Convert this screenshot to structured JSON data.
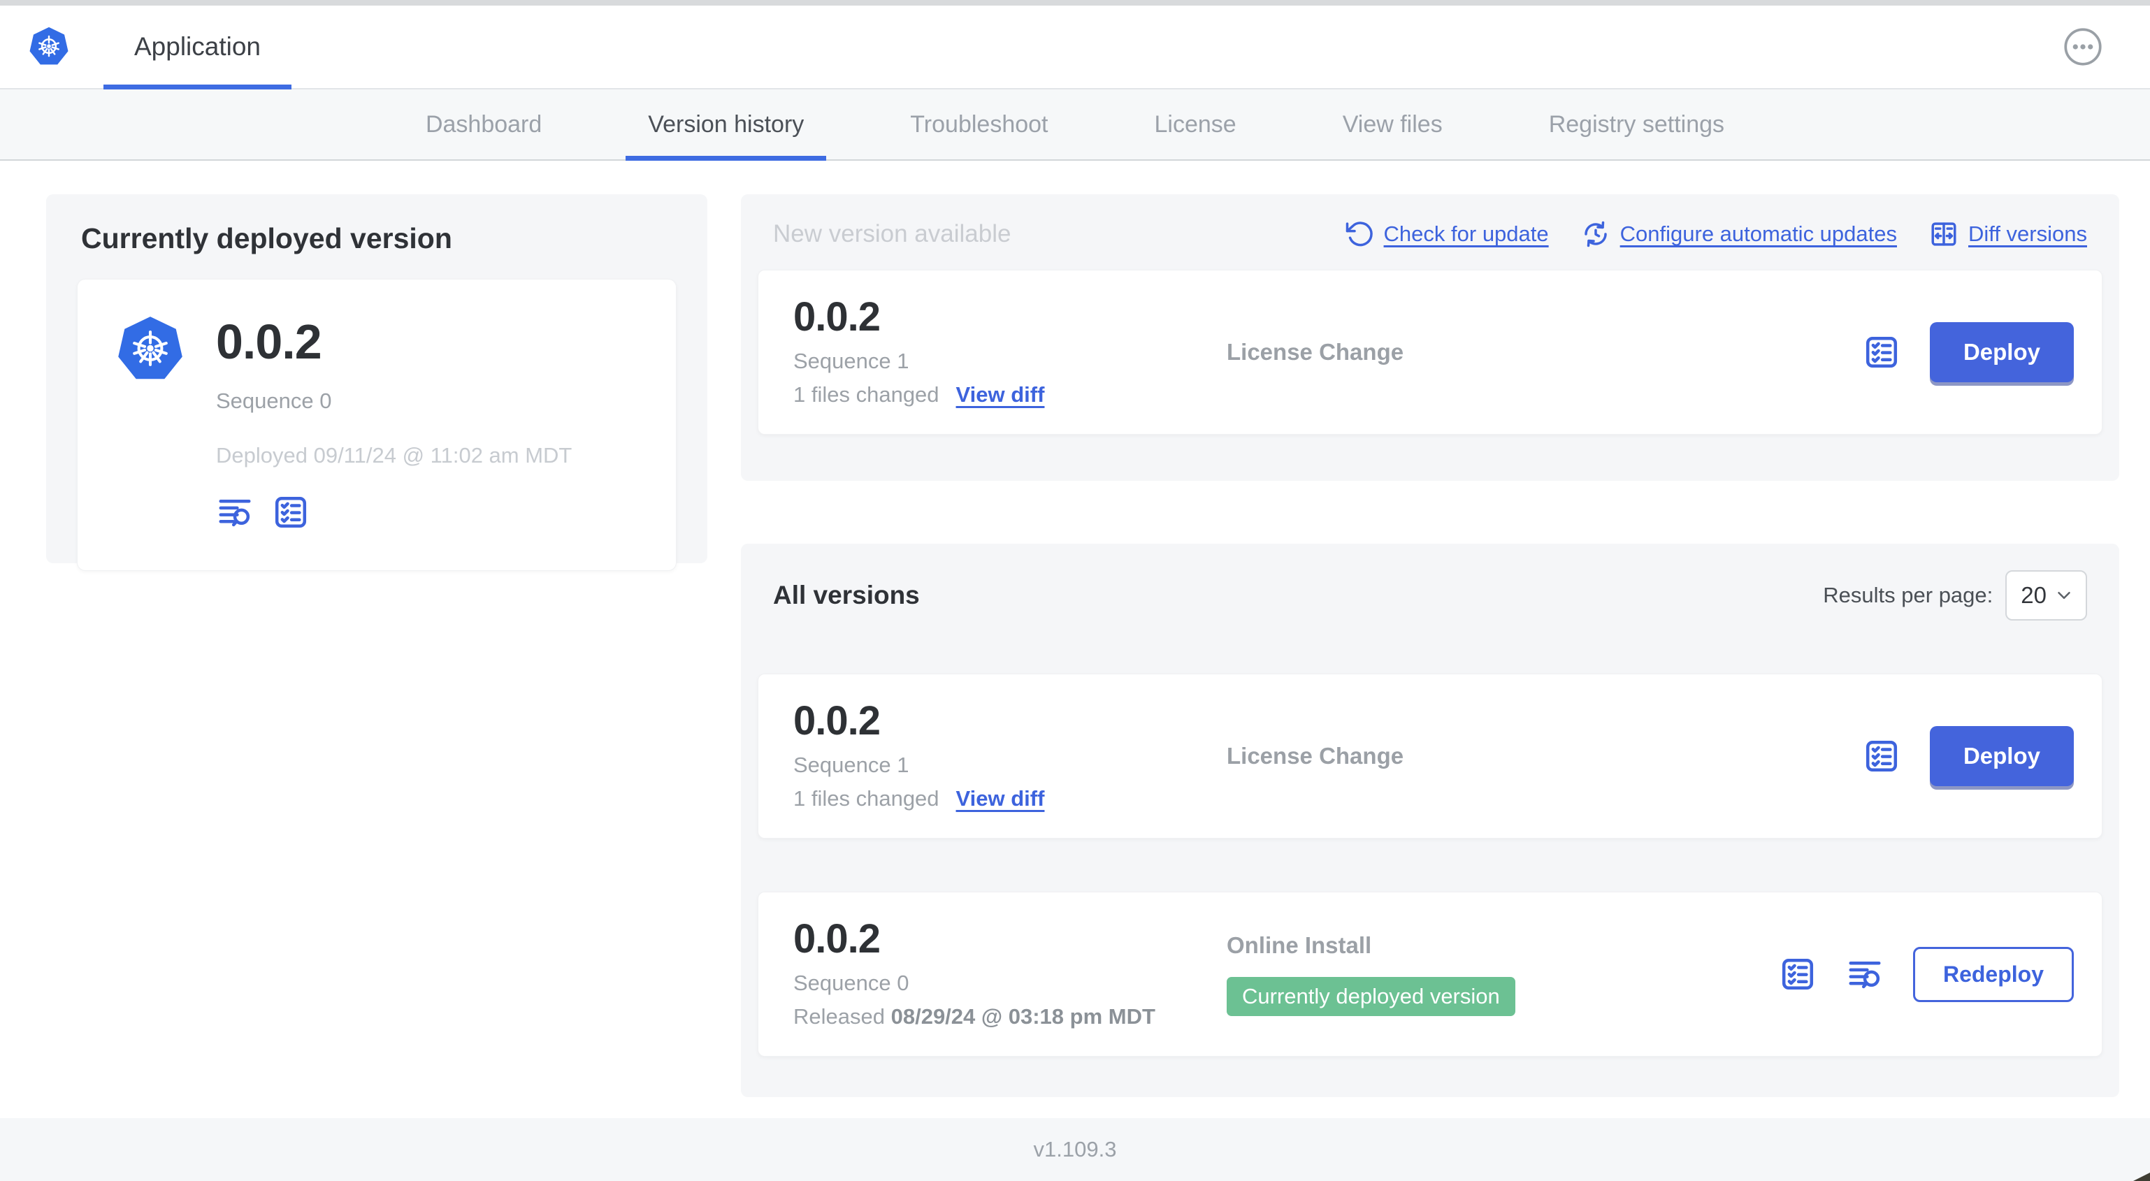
{
  "colors": {
    "accent_blue": "#3d63dd",
    "tab_underline": "#3e6ce2",
    "button_blue": "#4464dc",
    "badge_green": "#6cc193",
    "kubernetes_blue": "#326ce5"
  },
  "header": {
    "app_tab_label": "Application"
  },
  "nav": {
    "tabs": [
      "Dashboard",
      "Version history",
      "Troubleshoot",
      "License",
      "View files",
      "Registry settings"
    ],
    "active_tab": "Version history"
  },
  "current_version_panel": {
    "title": "Currently deployed version",
    "version": "0.0.2",
    "sequence": "Sequence 0",
    "deployed": "Deployed 09/11/24 @ 11:02 am MDT"
  },
  "new_version_panel": {
    "title": "New version available",
    "actions": {
      "check": "Check for update",
      "configure": "Configure automatic updates",
      "diff": "Diff versions"
    },
    "card": {
      "version": "0.0.2",
      "sequence": "Sequence 1",
      "files_changed": "1 files changed",
      "view_diff": "View diff",
      "source": "License Change",
      "deploy_label": "Deploy"
    }
  },
  "all_versions_panel": {
    "title": "All versions",
    "results_per_page_label": "Results per page:",
    "results_per_page_value": "20",
    "rows": [
      {
        "version": "0.0.2",
        "sequence": "Sequence 1",
        "files_changed": "1 files changed",
        "view_diff": "View diff",
        "source": "License Change",
        "button_label": "Deploy"
      },
      {
        "version": "0.0.2",
        "sequence": "Sequence 0",
        "released_label": "Released",
        "released_date": "08/29/24 @ 03:18 pm MDT",
        "source": "Online Install",
        "badge": "Currently deployed version",
        "button_label": "Redeploy"
      }
    ]
  },
  "footer": {
    "app_version": "v1.109.3"
  }
}
